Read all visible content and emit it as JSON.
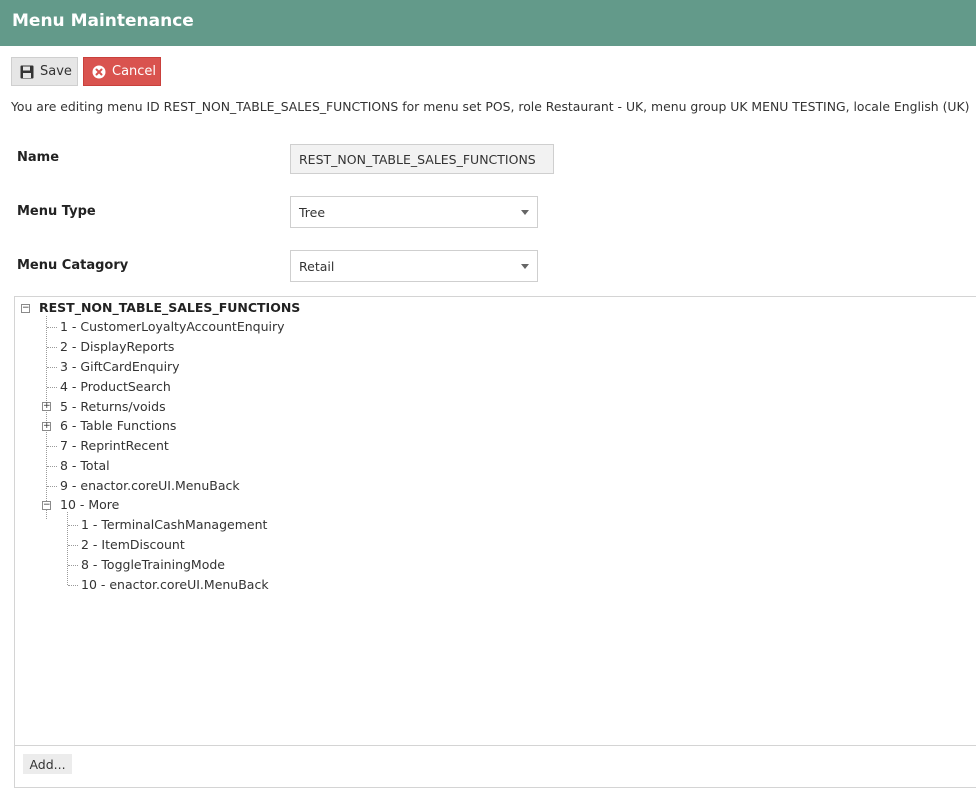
{
  "window": {
    "title": "Menu Maintenance"
  },
  "toolbar": {
    "save_label": "Save",
    "cancel_label": "Cancel"
  },
  "info_text": "You are editing menu ID REST_NON_TABLE_SALES_FUNCTIONS for menu set POS, role Restaurant - UK, menu group UK MENU TESTING, locale English (UK)",
  "form": {
    "name_label": "Name",
    "name_value": "REST_NON_TABLE_SALES_FUNCTIONS",
    "menu_type_label": "Menu Type",
    "menu_type_value": "Tree",
    "menu_category_label": "Menu Catagory",
    "menu_category_value": "Retail"
  },
  "tree": {
    "root": "REST_NON_TABLE_SALES_FUNCTIONS",
    "items": [
      "1 - CustomerLoyaltyAccountEnquiry",
      "2 - DisplayReports",
      "3 - GiftCardEnquiry",
      "4 - ProductSearch",
      "5 - Returns/voids",
      "6 - Table Functions",
      "7 - ReprintRecent",
      "8 - Total",
      "9 - enactor.coreUI.MenuBack",
      "10 - More"
    ],
    "more_children": [
      "1 - TerminalCashManagement",
      "2 - ItemDiscount",
      "8 - ToggleTrainingMode",
      "10 - enactor.coreUI.MenuBack"
    ],
    "add_label": "Add..."
  }
}
